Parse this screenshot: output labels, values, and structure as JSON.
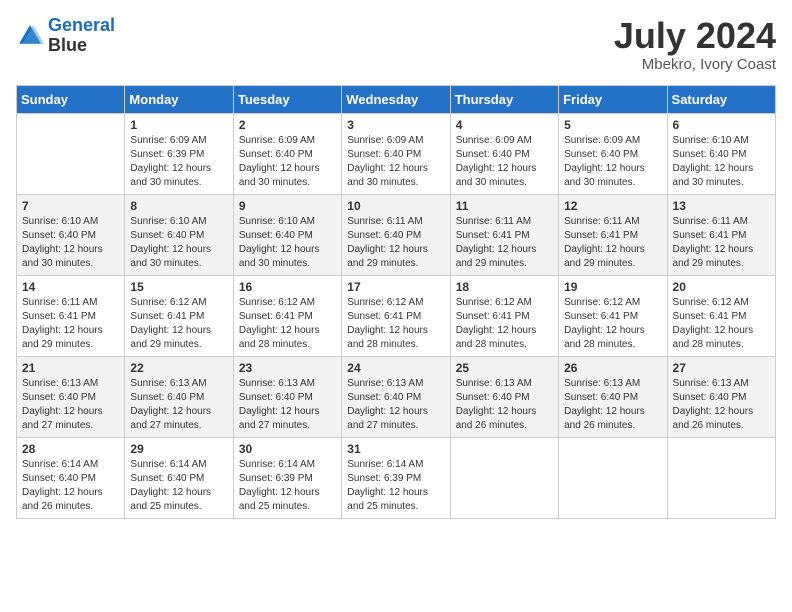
{
  "header": {
    "logo_line1": "General",
    "logo_line2": "Blue",
    "title": "July 2024",
    "subtitle": "Mbekro, Ivory Coast"
  },
  "columns": [
    "Sunday",
    "Monday",
    "Tuesday",
    "Wednesday",
    "Thursday",
    "Friday",
    "Saturday"
  ],
  "weeks": [
    [
      {
        "day": "",
        "empty": true
      },
      {
        "day": "1",
        "sunrise": "6:09 AM",
        "sunset": "6:39 PM",
        "daylight": "12 hours and 30 minutes."
      },
      {
        "day": "2",
        "sunrise": "6:09 AM",
        "sunset": "6:40 PM",
        "daylight": "12 hours and 30 minutes."
      },
      {
        "day": "3",
        "sunrise": "6:09 AM",
        "sunset": "6:40 PM",
        "daylight": "12 hours and 30 minutes."
      },
      {
        "day": "4",
        "sunrise": "6:09 AM",
        "sunset": "6:40 PM",
        "daylight": "12 hours and 30 minutes."
      },
      {
        "day": "5",
        "sunrise": "6:09 AM",
        "sunset": "6:40 PM",
        "daylight": "12 hours and 30 minutes."
      },
      {
        "day": "6",
        "sunrise": "6:10 AM",
        "sunset": "6:40 PM",
        "daylight": "12 hours and 30 minutes."
      }
    ],
    [
      {
        "day": "7",
        "sunrise": "6:10 AM",
        "sunset": "6:40 PM",
        "daylight": "12 hours and 30 minutes."
      },
      {
        "day": "8",
        "sunrise": "6:10 AM",
        "sunset": "6:40 PM",
        "daylight": "12 hours and 30 minutes."
      },
      {
        "day": "9",
        "sunrise": "6:10 AM",
        "sunset": "6:40 PM",
        "daylight": "12 hours and 30 minutes."
      },
      {
        "day": "10",
        "sunrise": "6:11 AM",
        "sunset": "6:40 PM",
        "daylight": "12 hours and 29 minutes."
      },
      {
        "day": "11",
        "sunrise": "6:11 AM",
        "sunset": "6:41 PM",
        "daylight": "12 hours and 29 minutes."
      },
      {
        "day": "12",
        "sunrise": "6:11 AM",
        "sunset": "6:41 PM",
        "daylight": "12 hours and 29 minutes."
      },
      {
        "day": "13",
        "sunrise": "6:11 AM",
        "sunset": "6:41 PM",
        "daylight": "12 hours and 29 minutes."
      }
    ],
    [
      {
        "day": "14",
        "sunrise": "6:11 AM",
        "sunset": "6:41 PM",
        "daylight": "12 hours and 29 minutes."
      },
      {
        "day": "15",
        "sunrise": "6:12 AM",
        "sunset": "6:41 PM",
        "daylight": "12 hours and 29 minutes."
      },
      {
        "day": "16",
        "sunrise": "6:12 AM",
        "sunset": "6:41 PM",
        "daylight": "12 hours and 28 minutes."
      },
      {
        "day": "17",
        "sunrise": "6:12 AM",
        "sunset": "6:41 PM",
        "daylight": "12 hours and 28 minutes."
      },
      {
        "day": "18",
        "sunrise": "6:12 AM",
        "sunset": "6:41 PM",
        "daylight": "12 hours and 28 minutes."
      },
      {
        "day": "19",
        "sunrise": "6:12 AM",
        "sunset": "6:41 PM",
        "daylight": "12 hours and 28 minutes."
      },
      {
        "day": "20",
        "sunrise": "6:12 AM",
        "sunset": "6:41 PM",
        "daylight": "12 hours and 28 minutes."
      }
    ],
    [
      {
        "day": "21",
        "sunrise": "6:13 AM",
        "sunset": "6:40 PM",
        "daylight": "12 hours and 27 minutes."
      },
      {
        "day": "22",
        "sunrise": "6:13 AM",
        "sunset": "6:40 PM",
        "daylight": "12 hours and 27 minutes."
      },
      {
        "day": "23",
        "sunrise": "6:13 AM",
        "sunset": "6:40 PM",
        "daylight": "12 hours and 27 minutes."
      },
      {
        "day": "24",
        "sunrise": "6:13 AM",
        "sunset": "6:40 PM",
        "daylight": "12 hours and 27 minutes."
      },
      {
        "day": "25",
        "sunrise": "6:13 AM",
        "sunset": "6:40 PM",
        "daylight": "12 hours and 26 minutes."
      },
      {
        "day": "26",
        "sunrise": "6:13 AM",
        "sunset": "6:40 PM",
        "daylight": "12 hours and 26 minutes."
      },
      {
        "day": "27",
        "sunrise": "6:13 AM",
        "sunset": "6:40 PM",
        "daylight": "12 hours and 26 minutes."
      }
    ],
    [
      {
        "day": "28",
        "sunrise": "6:14 AM",
        "sunset": "6:40 PM",
        "daylight": "12 hours and 26 minutes."
      },
      {
        "day": "29",
        "sunrise": "6:14 AM",
        "sunset": "6:40 PM",
        "daylight": "12 hours and 25 minutes."
      },
      {
        "day": "30",
        "sunrise": "6:14 AM",
        "sunset": "6:39 PM",
        "daylight": "12 hours and 25 minutes."
      },
      {
        "day": "31",
        "sunrise": "6:14 AM",
        "sunset": "6:39 PM",
        "daylight": "12 hours and 25 minutes."
      },
      {
        "day": "",
        "empty": true
      },
      {
        "day": "",
        "empty": true
      },
      {
        "day": "",
        "empty": true
      }
    ]
  ]
}
